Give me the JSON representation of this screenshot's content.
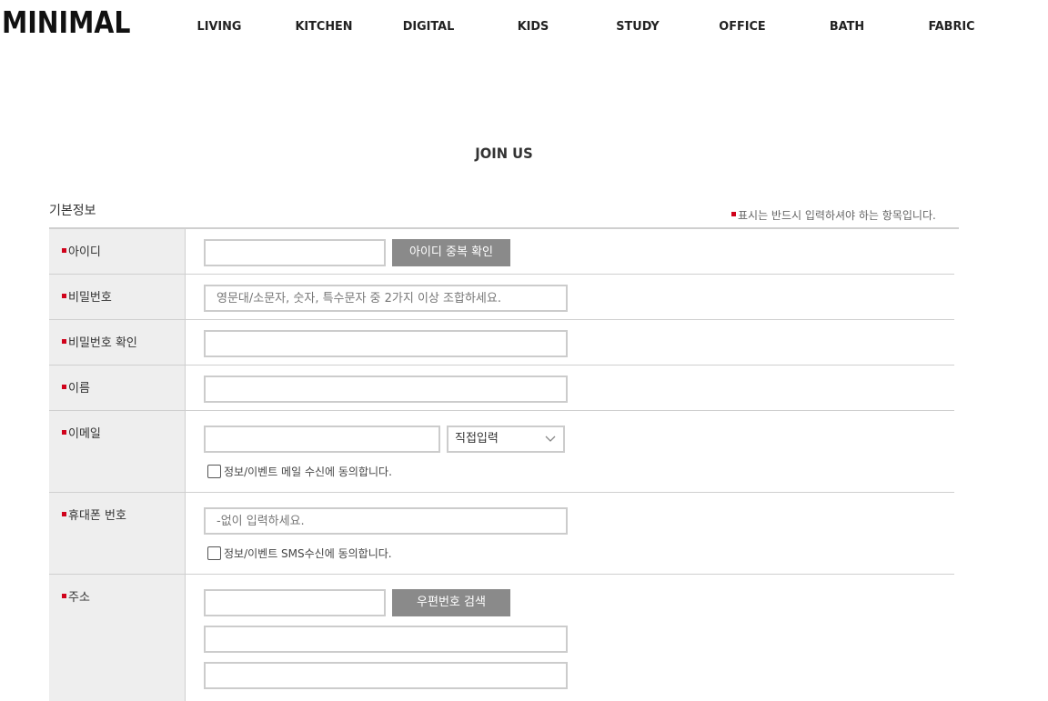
{
  "header": {
    "logo": "MINIMAL",
    "nav": [
      "LIVING",
      "KITCHEN",
      "DIGITAL",
      "KIDS",
      "STUDY",
      "OFFICE",
      "BATH",
      "FABRIC"
    ]
  },
  "page_title": "JOIN US",
  "section_title": "기본정보",
  "required_note": "표시는 반드시 입력하셔야 하는 항목입니다.",
  "colors": {
    "required_mark": "#d0021b",
    "button_bg": "#8a8a8a",
    "label_bg": "#eeeeee"
  },
  "form": {
    "id": {
      "label": "아이디",
      "value": "",
      "button": "아이디 중복 확인"
    },
    "password": {
      "label": "비밀번호",
      "placeholder": "영문대/소문자, 숫자, 특수문자 중 2가지 이상 조합하세요."
    },
    "password_confirm": {
      "label": "비밀번호 확인",
      "value": ""
    },
    "name": {
      "label": "이름",
      "value": ""
    },
    "email": {
      "label": "이메일",
      "value": "",
      "domain_select": "직접입력",
      "agree_label": "정보/이벤트 메일 수신에 동의합니다.",
      "agree_checked": false
    },
    "phone": {
      "label": "휴대폰 번호",
      "placeholder": "-없이 입력하세요.",
      "agree_label": "정보/이벤트 SMS수신에 동의합니다.",
      "agree_checked": false
    },
    "address": {
      "label": "주소",
      "zip_value": "",
      "button": "우편번호 검색",
      "line1_value": "",
      "line2_value": ""
    }
  },
  "icons": {
    "required": "red-square",
    "select": "chevron-down-icon"
  }
}
